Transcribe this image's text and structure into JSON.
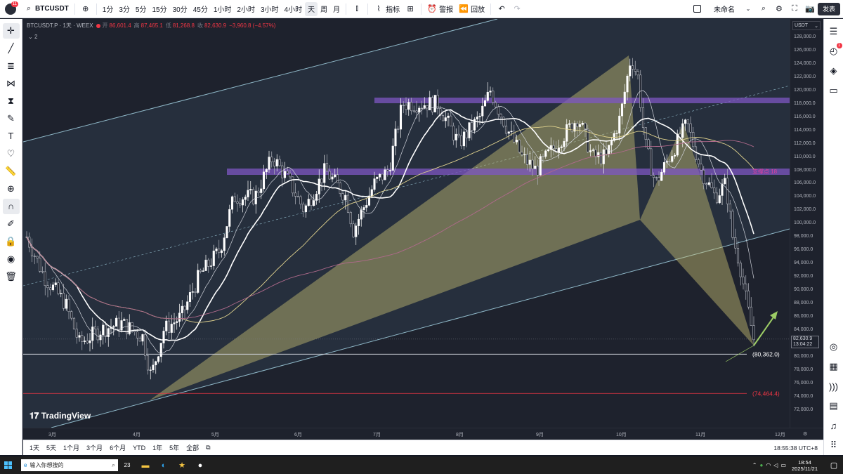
{
  "topbar": {
    "badge": "11",
    "symbol": "BTCUSDT",
    "intervals": [
      "1分",
      "3分",
      "5分",
      "15分",
      "30分",
      "45分",
      "1小时",
      "2小时",
      "3小时",
      "4小时",
      "天",
      "周",
      "月"
    ],
    "active_interval": "天",
    "indicators_label": "指标",
    "alert_label": "警报",
    "replay_label": "回放",
    "layout_name": "未命名",
    "publish_label": "发表"
  },
  "legend": {
    "symbol": "BTCUSDT.P · 1天 · WEEX",
    "open_key": "开",
    "open": "86,601.4",
    "high_key": "高",
    "high": "87,465.1",
    "low_key": "低",
    "low": "81,268.8",
    "close_key": "收",
    "close": "82,630.9",
    "change": "−3,960.8 (−4.57%)",
    "indicator_count": "2"
  },
  "chart_labels": {
    "resistance": "支撑点 18",
    "level_low": "(80,362.0)",
    "level_lower": "(74,464.4)",
    "watermark": "TradingView"
  },
  "price_axis": {
    "currency": "USDT",
    "ticks": [
      "128,000.0",
      "126,000.0",
      "124,000.0",
      "122,000.0",
      "120,000.0",
      "118,000.0",
      "116,000.0",
      "114,000.0",
      "112,000.0",
      "110,000.0",
      "108,000.0",
      "106,000.0",
      "104,000.0",
      "102,000.0",
      "100,000.0",
      "98,000.0",
      "96,000.0",
      "94,000.0",
      "92,000.0",
      "90,000.0",
      "88,000.0",
      "86,000.0",
      "84,000.0",
      "82,000.0",
      "80,000.0",
      "78,000.0",
      "76,000.0",
      "74,000.0",
      "72,000.0"
    ],
    "last_price": "82,630.9",
    "countdown": "13:04:22"
  },
  "time_axis": [
    "3月",
    "4月",
    "5月",
    "6月",
    "7月",
    "8月",
    "9月",
    "10月",
    "11月",
    "12月"
  ],
  "rangebar": {
    "ranges": [
      "1天",
      "5天",
      "1个月",
      "3个月",
      "6个月",
      "YTD",
      "1年",
      "5年",
      "全部"
    ],
    "clock": "18:55:38 UTC+8"
  },
  "taskbar": {
    "search_placeholder": "输入你想搜的",
    "badge": "23",
    "time": "18:54",
    "date": "2025/11/21"
  },
  "colors": {
    "bg": "#1e222d",
    "band": "#2e3a4a",
    "resistance": "#7e57c2",
    "triangle": "#c9c173",
    "up": "#ffffff",
    "ma_fast": "#ffffff",
    "ma_slow": "#e1d38e",
    "ma_long": "#b06a8c",
    "red_level": "#f23645"
  }
}
